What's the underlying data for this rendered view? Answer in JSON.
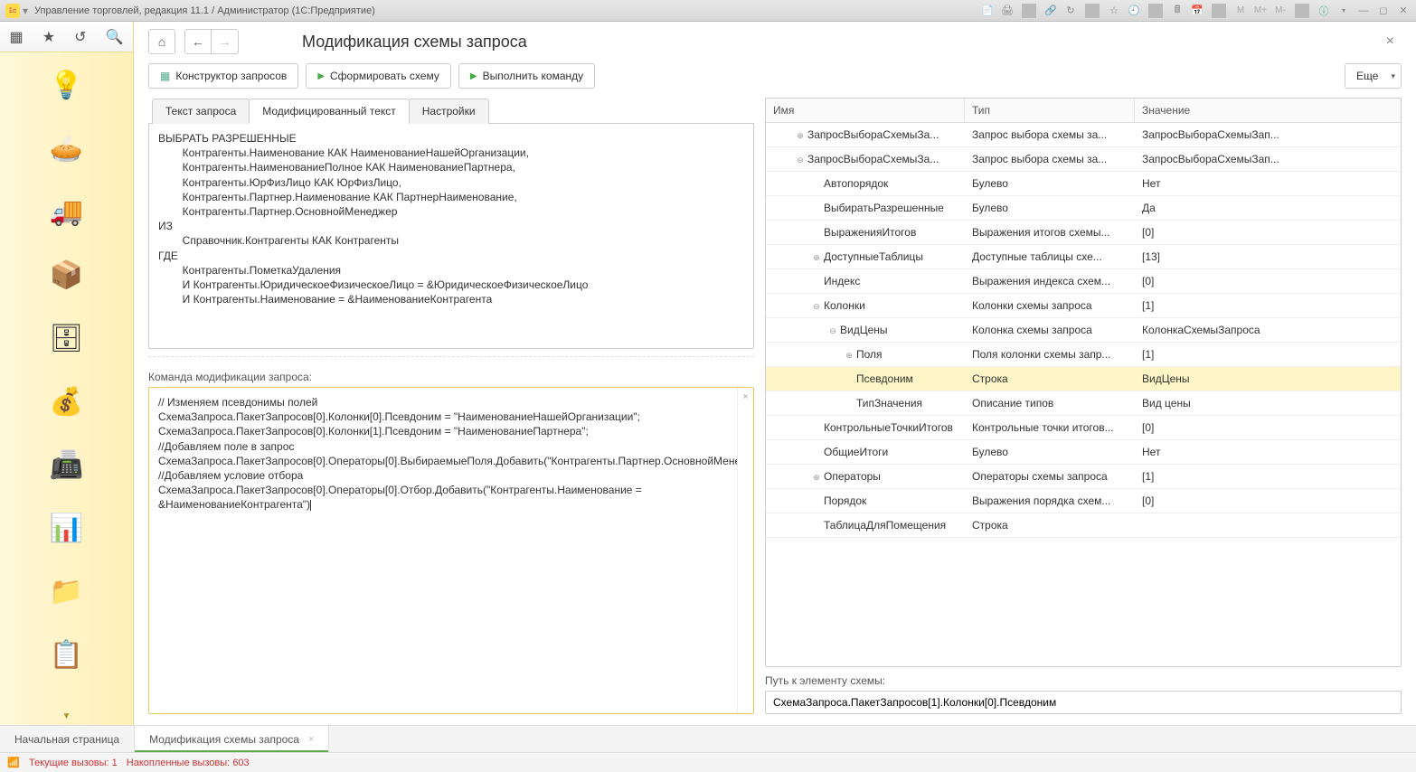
{
  "window": {
    "title": "Управление торговлей, редакция 11.1 / Администратор  (1С:Предприятие)"
  },
  "page": {
    "title": "Модификация схемы запроса",
    "btn_constructor": "Конструктор запросов",
    "btn_build": "Сформировать схему",
    "btn_execute": "Выполнить команду",
    "btn_more": "Еще",
    "tab_text": "Текст запроса",
    "tab_mod": "Модифицированный текст",
    "tab_settings": "Настройки",
    "cmd_label": "Команда модификации запроса:",
    "path_label": "Путь к элементу схемы:",
    "path_value": "СхемаЗапроса.ПакетЗапросов[1].Колонки[0].Псевдоним"
  },
  "query_text": "ВЫБРАТЬ РАЗРЕШЕННЫЕ\n        Контрагенты.Наименование КАК НаименованиеНашейОрганизации,\n        Контрагенты.НаименованиеПолное КАК НаименованиеПартнера,\n        Контрагенты.ЮрФизЛицо КАК ЮрФизЛицо,\n        Контрагенты.Партнер.Наименование КАК ПартнерНаименование,\n        Контрагенты.Партнер.ОсновнойМенеджер\nИЗ\n        Справочник.Контрагенты КАК Контрагенты\nГДЕ\n        Контрагенты.ПометкаУдаления\n        И Контрагенты.ЮридическоеФизическоеЛицо = &ЮридическоеФизическоеЛицо\n        И Контрагенты.Наименование = &НаименованиеКонтрагента",
  "command_text": "// Изменяем псевдонимы полей\nСхемаЗапроса.ПакетЗапросов[0].Колонки[0].Псевдоним = \"НаименованиеНашейОрганизации\";\nСхемаЗапроса.ПакетЗапросов[0].Колонки[1].Псевдоним = \"НаименованиеПартнера\";\n//Добавляем поле в запрос\nСхемаЗапроса.ПакетЗапросов[0].Операторы[0].ВыбираемыеПоля.Добавить(\"Контрагенты.Партнер.ОсновнойМенеджер\");\n//Добавляем условие отбора\nСхемаЗапроса.ПакетЗапросов[0].Операторы[0].Отбор.Добавить(\"Контрагенты.Наименование = &НаименованиеКонтрагента\")",
  "tree": {
    "col_name": "Имя",
    "col_type": "Тип",
    "col_value": "Значение",
    "rows": [
      {
        "indent": 1,
        "toggle": "+",
        "name": "ЗапросВыбораСхемыЗа...",
        "type": "Запрос выбора схемы за...",
        "value": "ЗапросВыбораСхемыЗап..."
      },
      {
        "indent": 1,
        "toggle": "-",
        "name": "ЗапросВыбораСхемыЗа...",
        "type": "Запрос выбора схемы за...",
        "value": "ЗапросВыбораСхемыЗап..."
      },
      {
        "indent": 2,
        "toggle": "",
        "name": "Автопорядок",
        "type": "Булево",
        "value": "Нет"
      },
      {
        "indent": 2,
        "toggle": "",
        "name": "ВыбиратьРазрешенные",
        "type": "Булево",
        "value": "Да"
      },
      {
        "indent": 2,
        "toggle": "",
        "name": "ВыраженияИтогов",
        "type": "Выражения итогов схемы...",
        "value": "[0]"
      },
      {
        "indent": 2,
        "toggle": "+",
        "name": "ДоступныеТаблицы",
        "type": "Доступные таблицы схе...",
        "value": "[13]"
      },
      {
        "indent": 2,
        "toggle": "",
        "name": "Индекс",
        "type": "Выражения индекса схем...",
        "value": "[0]"
      },
      {
        "indent": 2,
        "toggle": "-",
        "name": "Колонки",
        "type": "Колонки схемы запроса",
        "value": "[1]"
      },
      {
        "indent": 3,
        "toggle": "-",
        "name": "ВидЦены",
        "type": "Колонка схемы запроса",
        "value": "КолонкаСхемыЗапроса"
      },
      {
        "indent": 4,
        "toggle": "+",
        "name": "Поля",
        "type": "Поля колонки схемы запр...",
        "value": "[1]"
      },
      {
        "indent": 4,
        "toggle": "",
        "name": "Псевдоним",
        "type": "Строка",
        "value": "ВидЦены",
        "selected": true
      },
      {
        "indent": 4,
        "toggle": "",
        "name": "ТипЗначения",
        "type": "Описание типов",
        "value": "Вид цены"
      },
      {
        "indent": 2,
        "toggle": "",
        "name": "КонтрольныеТочкиИтогов",
        "type": "Контрольные точки итогов...",
        "value": "[0]"
      },
      {
        "indent": 2,
        "toggle": "",
        "name": "ОбщиеИтоги",
        "type": "Булево",
        "value": "Нет"
      },
      {
        "indent": 2,
        "toggle": "+",
        "name": "Операторы",
        "type": "Операторы схемы запроса",
        "value": "[1]"
      },
      {
        "indent": 2,
        "toggle": "",
        "name": "Порядок",
        "type": "Выражения порядка схем...",
        "value": "[0]"
      },
      {
        "indent": 2,
        "toggle": "",
        "name": "ТаблицаДляПомещения",
        "type": "Строка",
        "value": ""
      }
    ]
  },
  "bottom_tabs": {
    "home": "Начальная страница",
    "mod": "Модификация схемы запроса"
  },
  "status": {
    "current": "Текущие вызовы: 1",
    "accumulated": "Накопленные вызовы: 603"
  }
}
